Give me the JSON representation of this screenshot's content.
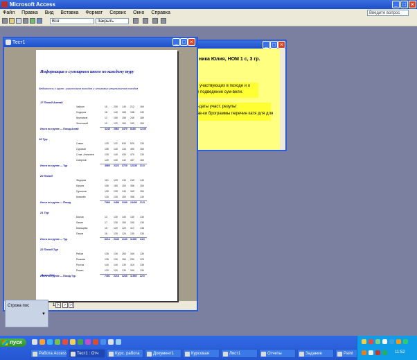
{
  "app": {
    "title": "Microsoft Access",
    "menu": [
      "Файл",
      "Правка",
      "Вид",
      "Вставка",
      "Формат",
      "Сервис",
      "Окно",
      "Справка"
    ],
    "help_placeholder": "Введите вопрос",
    "toolbar_combo_1": "Вся",
    "toolbar_combo_2": "Закрыть"
  },
  "yellow_window": {
    "line1": "ника Юлия, НОМ 1 с, 3 гр.",
    "line2": "ий, участвующих в походе и о",
    "line3": "ссе подведение сум-вели.",
    "line4": "им-даты участ. результ",
    "line5": "прав-ки брограммы перечин катя для для"
  },
  "report_window": {
    "title": "Тест1",
    "page_number": "1",
    "report_title": "Информация о суммарном итоге по каждому туру",
    "report_subtitle": "Ведомость с групп. участников походов и итоговых результатов походов",
    "groups": [
      {
        "name": "17 Поход Алтай",
        "rows": [
          {
            "label": "Чайкин",
            "vals": [
              "15",
              "200",
              "140",
              "212",
              "160"
            ]
          },
          {
            "label": "Сидоров",
            "vals": [
              "18",
              "140",
              "165",
              "158",
              "130"
            ]
          },
          {
            "label": "Кругликов",
            "vals": [
              "12",
              "150",
              "155",
              "245",
              "180"
            ]
          },
          {
            "label": "Зеленский",
            "vals": [
              "10",
              "122",
              "160",
              "152",
              "150"
            ]
          }
        ],
        "total_label": "Итоги по группе — Поход Алтай",
        "total_vals": [
          "4245",
          "2562",
          "3470",
          "8180",
          "12.05"
        ]
      },
      {
        "name": "18 Тур",
        "rows": [
          {
            "label": "Савин",
            "vals": [
              "120",
              "122",
              "630",
              "520",
              "130"
            ]
          },
          {
            "label": "Суровой",
            "vals": [
              "105",
              "140",
              "133",
              "490",
              "150"
            ]
          },
          {
            "label": "Слав. Алексеев",
            "vals": [
              "130",
              "140",
              "430",
              "470",
              "130"
            ]
          },
          {
            "label": "Смирнов",
            "vals": [
              "120",
              "130",
              "142",
              "437",
              "160"
            ]
          }
        ],
        "total_label": "Итоги по группе — Тур",
        "total_vals": [
          "4560",
          "2222",
          "3720",
          "12130",
          "21.0"
        ]
      },
      {
        "name": "20 Поход",
        "rows": [
          {
            "label": "Федоров",
            "vals": [
              "110",
              "120",
              "130",
              "240",
              "140"
            ]
          },
          {
            "label": "Юрьев",
            "vals": [
              "105",
              "180",
              "150",
              "356",
              "150"
            ]
          },
          {
            "label": "Гурьянов",
            "vals": [
              "125",
              "130",
              "140",
              "340",
              "150"
            ]
          },
          {
            "label": "Ковалёв",
            "vals": [
              "130",
              "130",
              "150",
              "358",
              "130"
            ]
          }
        ],
        "total_label": "Итоги по группе — Поход",
        "total_vals": [
          "7060",
          "2456",
          "3160",
          "13430",
          "21.5"
        ]
      },
      {
        "name": "21 Тур",
        "rows": [
          {
            "label": "Малов",
            "vals": [
              "13",
              "130",
              "140",
              "130",
              "130"
            ]
          },
          {
            "label": "Лапин",
            "vals": [
              "17",
              "130",
              "150",
              "150",
              "130"
            ]
          },
          {
            "label": "Мальцева",
            "vals": [
              "15",
              "120",
              "120",
              "110",
              "135"
            ]
          },
          {
            "label": "Панов",
            "vals": [
              "16",
              "130",
              "120",
              "130",
              "130"
            ]
          }
        ],
        "total_label": "Итоги по группе — Тур",
        "total_vals": [
          "6214",
          "2340",
          "4140",
          "11190",
          "24.0"
        ]
      },
      {
        "name": "22 Поход Тур",
        "rows": [
          {
            "label": "Рябов",
            "vals": [
              "135",
              "130",
              "250",
              "340",
              "130"
            ]
          },
          {
            "label": "Рыжова",
            "vals": [
              "135",
              "130",
              "154",
              "250",
              "125"
            ]
          },
          {
            "label": "Ростов",
            "vals": [
              "140",
              "140",
              "130",
              "310",
              "135"
            ]
          },
          {
            "label": "Роман",
            "vals": [
              "120",
              "120",
              "130",
              "340",
              "130"
            ]
          }
        ],
        "total_label": "Итоги по группе — Поход Тур",
        "total_vals": [
          "7451",
          "2216",
          "3240",
          "11940",
          "22.0"
        ]
      }
    ],
    "footer": "Всего 2014"
  },
  "small_panel": {
    "label": "Строка пос"
  },
  "taskbar": {
    "start": "пуск",
    "tasks": [
      {
        "label": "Работа Access",
        "active": false
      },
      {
        "label": "Тест1 : Отч",
        "active": true
      },
      {
        "label": "Курс. работа",
        "active": false
      },
      {
        "label": "Документ1",
        "active": false
      },
      {
        "label": "Курсовая",
        "active": false
      },
      {
        "label": "Лист1",
        "active": false
      },
      {
        "label": "Отчеты",
        "active": false
      },
      {
        "label": "Задание",
        "active": false
      },
      {
        "label": "Paint",
        "active": false
      }
    ],
    "clock": "11:52"
  }
}
